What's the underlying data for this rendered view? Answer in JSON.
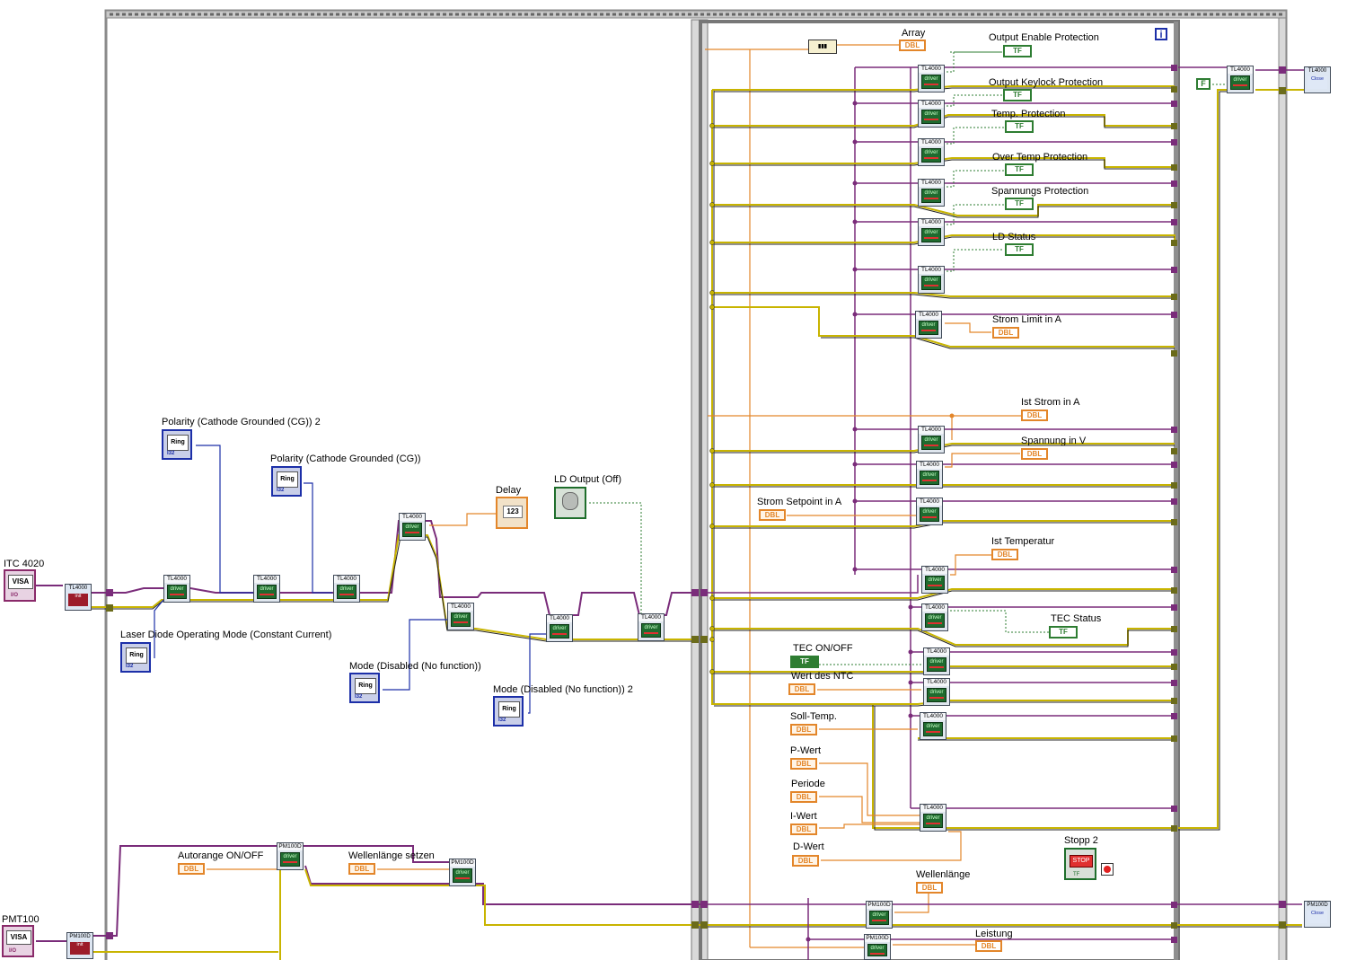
{
  "diagram": {
    "outer_labels": {
      "itc": "ITC 4020",
      "pmt": "PMT100"
    },
    "controls": {
      "polarity_cg2": "Polarity (Cathode Grounded (CG)) 2",
      "polarity_cg": "Polarity (Cathode Grounded (CG))",
      "ld_mode": "Laser Diode Operating Mode (Constant Current)",
      "mode_disabled": "Mode (Disabled (No function))",
      "mode_disabled2": "Mode (Disabled (No function)) 2",
      "delay": "Delay",
      "ld_output": "LD Output (Off)",
      "autorange": "Autorange ON/OFF",
      "wellenlaenge_setzen": "Wellenlänge setzen"
    },
    "loop_labels": {
      "array": "Array",
      "output_enable": "Output Enable Protection",
      "output_keylock": "Output Keylock Protection",
      "temp_protection": "Temp. Protection",
      "over_temp": "Over Temp Protection",
      "spannungs": "Spannungs Protection",
      "ld_status": "LD Status",
      "strom_limit": "Strom Limit in A",
      "ist_strom": "Ist Strom in A",
      "spannung": "Spannung in V",
      "strom_setpoint": "Strom Setpoint in A",
      "ist_temperatur": "Ist Temperatur",
      "tec_status": "TEC Status",
      "tec_onoff": "TEC ON/OFF",
      "wert_ntc": "Wert des NTC",
      "soll_temp": "Soll-Temp.",
      "p_wert": "P-Wert",
      "periode": "Periode",
      "i_wert": "I-Wert",
      "d_wert": "D-Wert",
      "stopp2": "Stopp 2",
      "wellenlaenge": "Wellenlänge",
      "leistung": "Leistung"
    },
    "terms": {
      "dbl": "DBL",
      "tf": "TF",
      "f": "F",
      "ring": "Ring",
      "i32": "I32",
      "visa": "VISA",
      "io": "I/O",
      "num": "123",
      "stop": "STOP",
      "iteration": "i"
    },
    "vi_text": {
      "tl4000": "TL4000",
      "pm100d": "PM100D",
      "driver": "driver",
      "close": "Close",
      "init": "init"
    }
  }
}
